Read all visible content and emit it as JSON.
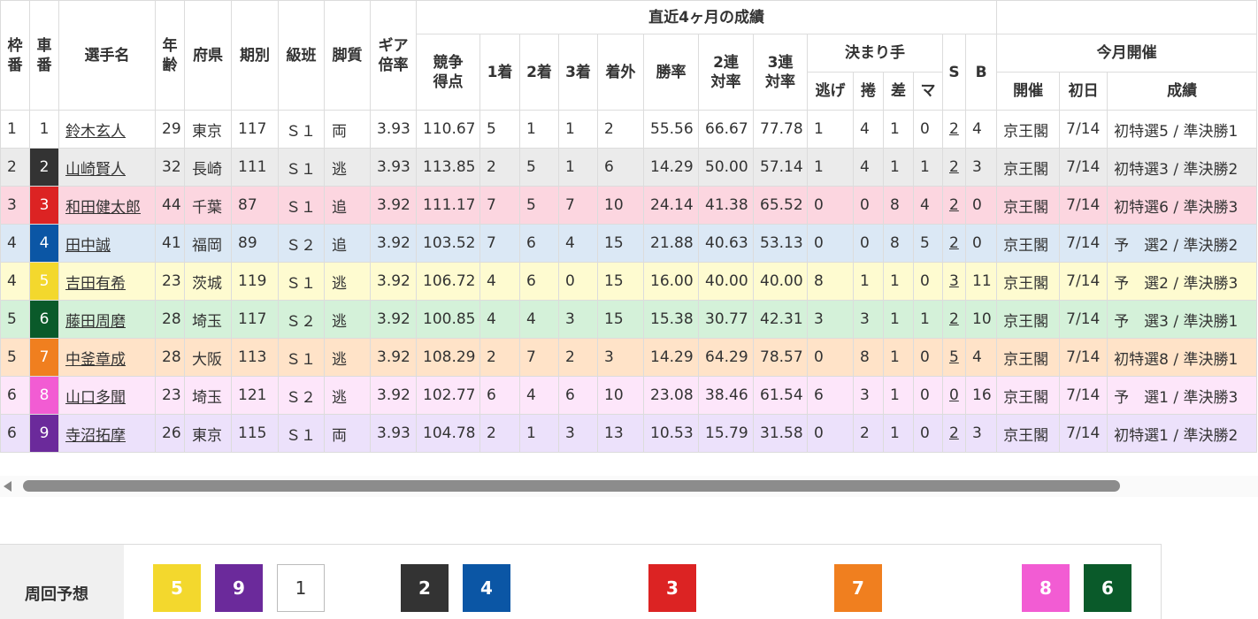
{
  "colors": {
    "row_bg": [
      "#ffffff",
      "#ebebeb",
      "#fcd6e0",
      "#dbe8f5",
      "#fefbd0",
      "#d4f1d9",
      "#ffe3c8",
      "#fde6fa",
      "#ece1fb"
    ],
    "car_bg": [
      "#ffffff",
      "#333333",
      "#dc2323",
      "#0b56a5",
      "#f3d82d",
      "#0a5a2a",
      "#f07f1f",
      "#f25cd3",
      "#6b2a9b"
    ],
    "car_fg": [
      "#333333",
      "#ffffff",
      "#ffffff",
      "#ffffff",
      "#ffffff",
      "#ffffff",
      "#ffffff",
      "#ffffff",
      "#ffffff"
    ]
  },
  "headers": {
    "waku": "枠番",
    "sha": "車番",
    "name": "選手名",
    "age": "年齢",
    "pref": "府県",
    "term": "期別",
    "class": "級班",
    "style": "脚質",
    "gear": "ギア倍率",
    "recent_group": "直近4ヶ月の成績",
    "score": "競争得点",
    "first": "1着",
    "second": "2着",
    "third": "3着",
    "out": "着外",
    "win_rate": "勝率",
    "rate2": "2連対率",
    "rate3": "3連対率",
    "kimarite": "決まり手",
    "nige": "逃げ",
    "makuri": "捲",
    "sashi": "差",
    "ma": "マ",
    "s": "S",
    "b": "B",
    "month_group": "今月開催",
    "venue": "開催",
    "first_day": "初日",
    "results": "成績"
  },
  "racers": [
    {
      "waku": "1",
      "sha": "1",
      "name": "鈴木玄人",
      "age": "29",
      "pref": "東京",
      "term": "117",
      "class": "Ｓ１",
      "style": "両",
      "gear": "3.93",
      "score": "110.67",
      "first": "5",
      "second": "1",
      "third": "1",
      "out": "2",
      "win_rate": "55.56",
      "rate2": "66.67",
      "rate3": "77.78",
      "nige": "1",
      "makuri": "4",
      "sashi": "1",
      "ma": "0",
      "s": "2",
      "b": "4",
      "venue": "京王閣",
      "first_day": "7/14",
      "results": "初特選5 / 準決勝1"
    },
    {
      "waku": "2",
      "sha": "2",
      "name": "山崎賢人",
      "age": "32",
      "pref": "長崎",
      "term": "111",
      "class": "Ｓ１",
      "style": "逃",
      "gear": "3.93",
      "score": "113.85",
      "first": "2",
      "second": "5",
      "third": "1",
      "out": "6",
      "win_rate": "14.29",
      "rate2": "50.00",
      "rate3": "57.14",
      "nige": "1",
      "makuri": "4",
      "sashi": "1",
      "ma": "1",
      "s": "2",
      "b": "3",
      "venue": "京王閣",
      "first_day": "7/14",
      "results": "初特選3 / 準決勝2"
    },
    {
      "waku": "3",
      "sha": "3",
      "name": "和田健太郎",
      "age": "44",
      "pref": "千葉",
      "term": "87",
      "class": "Ｓ１",
      "style": "追",
      "gear": "3.92",
      "score": "111.17",
      "first": "7",
      "second": "5",
      "third": "7",
      "out": "10",
      "win_rate": "24.14",
      "rate2": "41.38",
      "rate3": "65.52",
      "nige": "0",
      "makuri": "0",
      "sashi": "8",
      "ma": "4",
      "s": "2",
      "b": "0",
      "venue": "京王閣",
      "first_day": "7/14",
      "results": "初特選6 / 準決勝3"
    },
    {
      "waku": "4",
      "sha": "4",
      "name": "田中誠",
      "age": "41",
      "pref": "福岡",
      "term": "89",
      "class": "Ｓ２",
      "style": "追",
      "gear": "3.92",
      "score": "103.52",
      "first": "7",
      "second": "6",
      "third": "4",
      "out": "15",
      "win_rate": "21.88",
      "rate2": "40.63",
      "rate3": "53.13",
      "nige": "0",
      "makuri": "0",
      "sashi": "8",
      "ma": "5",
      "s": "2",
      "b": "0",
      "venue": "京王閣",
      "first_day": "7/14",
      "results": "予　選2 / 準決勝2"
    },
    {
      "waku": "4",
      "sha": "5",
      "name": "吉田有希",
      "age": "23",
      "pref": "茨城",
      "term": "119",
      "class": "Ｓ１",
      "style": "逃",
      "gear": "3.92",
      "score": "106.72",
      "first": "4",
      "second": "6",
      "third": "0",
      "out": "15",
      "win_rate": "16.00",
      "rate2": "40.00",
      "rate3": "40.00",
      "nige": "8",
      "makuri": "1",
      "sashi": "1",
      "ma": "0",
      "s": "3",
      "b": "11",
      "venue": "京王閣",
      "first_day": "7/14",
      "results": "予　選2 / 準決勝3"
    },
    {
      "waku": "5",
      "sha": "6",
      "name": "藤田周磨",
      "age": "28",
      "pref": "埼玉",
      "term": "117",
      "class": "Ｓ２",
      "style": "逃",
      "gear": "3.92",
      "score": "100.85",
      "first": "4",
      "second": "4",
      "third": "3",
      "out": "15",
      "win_rate": "15.38",
      "rate2": "30.77",
      "rate3": "42.31",
      "nige": "3",
      "makuri": "3",
      "sashi": "1",
      "ma": "1",
      "s": "2",
      "b": "10",
      "venue": "京王閣",
      "first_day": "7/14",
      "results": "予　選3 / 準決勝1"
    },
    {
      "waku": "5",
      "sha": "7",
      "name": "中釜章成",
      "age": "28",
      "pref": "大阪",
      "term": "113",
      "class": "Ｓ１",
      "style": "逃",
      "gear": "3.92",
      "score": "108.29",
      "first": "2",
      "second": "7",
      "third": "2",
      "out": "3",
      "win_rate": "14.29",
      "rate2": "64.29",
      "rate3": "78.57",
      "nige": "0",
      "makuri": "8",
      "sashi": "1",
      "ma": "0",
      "s": "5",
      "b": "4",
      "venue": "京王閣",
      "first_day": "7/14",
      "results": "初特選8 / 準決勝1"
    },
    {
      "waku": "6",
      "sha": "8",
      "name": "山口多聞",
      "age": "23",
      "pref": "埼玉",
      "term": "121",
      "class": "Ｓ２",
      "style": "逃",
      "gear": "3.92",
      "score": "102.77",
      "first": "6",
      "second": "4",
      "third": "6",
      "out": "10",
      "win_rate": "23.08",
      "rate2": "38.46",
      "rate3": "61.54",
      "nige": "6",
      "makuri": "3",
      "sashi": "1",
      "ma": "0",
      "s": "0",
      "b": "16",
      "venue": "京王閣",
      "first_day": "7/14",
      "results": "予　選1 / 準決勝3"
    },
    {
      "waku": "6",
      "sha": "9",
      "name": "寺沼拓摩",
      "age": "26",
      "pref": "東京",
      "term": "115",
      "class": "Ｓ１",
      "style": "両",
      "gear": "3.93",
      "score": "104.78",
      "first": "2",
      "second": "1",
      "third": "3",
      "out": "13",
      "win_rate": "10.53",
      "rate2": "15.79",
      "rate3": "31.58",
      "nige": "0",
      "makuri": "2",
      "sashi": "1",
      "ma": "0",
      "s": "2",
      "b": "3",
      "venue": "京王閣",
      "first_day": "7/14",
      "results": "初特選1 / 準決勝2"
    }
  ],
  "prediction": {
    "label": "周回予想",
    "order": [
      "5",
      "9",
      "1",
      "2",
      "4",
      "3",
      "7",
      "8",
      "6"
    ]
  }
}
